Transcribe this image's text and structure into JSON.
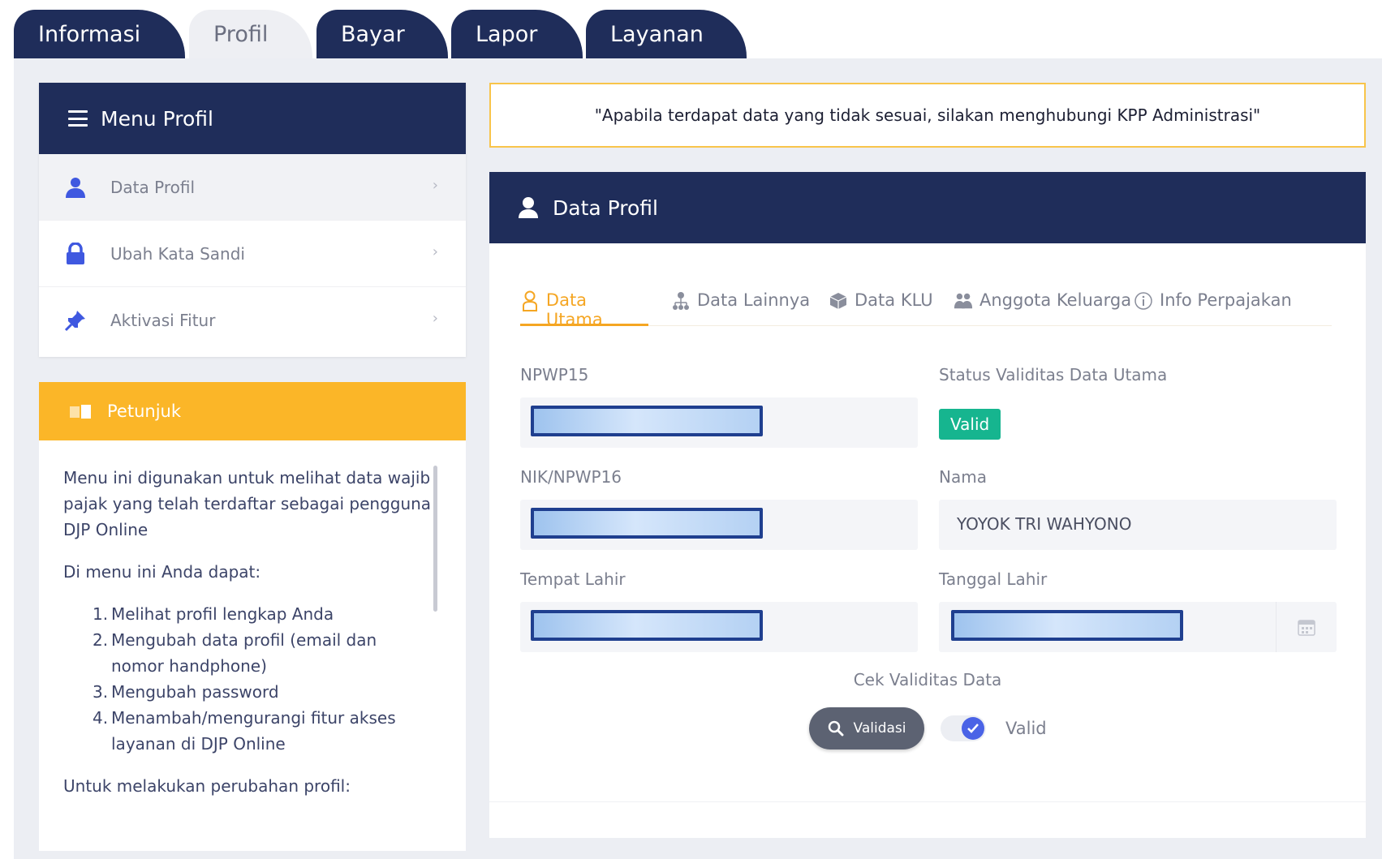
{
  "tabs": [
    {
      "label": "Informasi",
      "active": false
    },
    {
      "label": "Profil",
      "active": true
    },
    {
      "label": "Bayar",
      "active": false
    },
    {
      "label": "Lapor",
      "active": false
    },
    {
      "label": "Layanan",
      "active": false
    }
  ],
  "menu": {
    "title": "Menu Profil",
    "items": [
      {
        "label": "Data Profil",
        "icon": "user-icon",
        "active": true
      },
      {
        "label": "Ubah Kata Sandi",
        "icon": "lock-icon",
        "active": false
      },
      {
        "label": "Aktivasi Fitur",
        "icon": "pin-icon",
        "active": false
      }
    ]
  },
  "petunjuk": {
    "title": "Petunjuk",
    "intro": [
      "Menu ini digunakan untuk melihat data wajib",
      "pajak yang telah terdaftar sebagai pengguna",
      "DJP Online"
    ],
    "subhead": "Di menu ini Anda dapat:",
    "list": [
      {
        "num": "1.",
        "lines": [
          "Melihat profil lengkap Anda"
        ]
      },
      {
        "num": "2.",
        "lines": [
          "Mengubah data profil (email dan",
          "nomor handphone)"
        ]
      },
      {
        "num": "3.",
        "lines": [
          "Mengubah password"
        ]
      },
      {
        "num": "4.",
        "lines": [
          "Menambah/mengurangi fitur akses",
          "layanan di DJP Online"
        ]
      }
    ],
    "footer": "Untuk melakukan perubahan profil:"
  },
  "notice": "\"Apabila terdapat data yang tidak sesuai, silakan menghubungi KPP Administrasi\"",
  "profil": {
    "title": "Data Profil",
    "subtabs": [
      {
        "label": "Data Utama",
        "icon": "user-outline-icon",
        "active": true
      },
      {
        "label": "Data Lainnya",
        "icon": "users-tree-icon",
        "active": false
      },
      {
        "label": "Data KLU",
        "icon": "cube-icon",
        "active": false
      },
      {
        "label": "Anggota Keluarga",
        "icon": "family-icon",
        "active": false
      },
      {
        "label": "Info Perpajakan",
        "icon": "info-icon",
        "active": false
      }
    ],
    "fields": {
      "npwp15_label": "NPWP15",
      "status_label": "Status Validitas Data Utama",
      "status_value": "Valid",
      "nik_label": "NIK/NPWP16",
      "nama_label": "Nama",
      "nama_value": "YOYOK TRI WAHYONO",
      "tempat_label": "Tempat Lahir",
      "tanggal_label": "Tanggal Lahir"
    },
    "cek_label": "Cek Validitas Data",
    "validasi_button": "Validasi",
    "toggle_label": "Valid",
    "toggle_on": true
  },
  "colors": {
    "navy": "#1f2d5a",
    "amber": "#fbb628",
    "orange_active": "#f5a623",
    "green_badge": "#16b58f",
    "toggle_blue": "#4a63e6"
  }
}
